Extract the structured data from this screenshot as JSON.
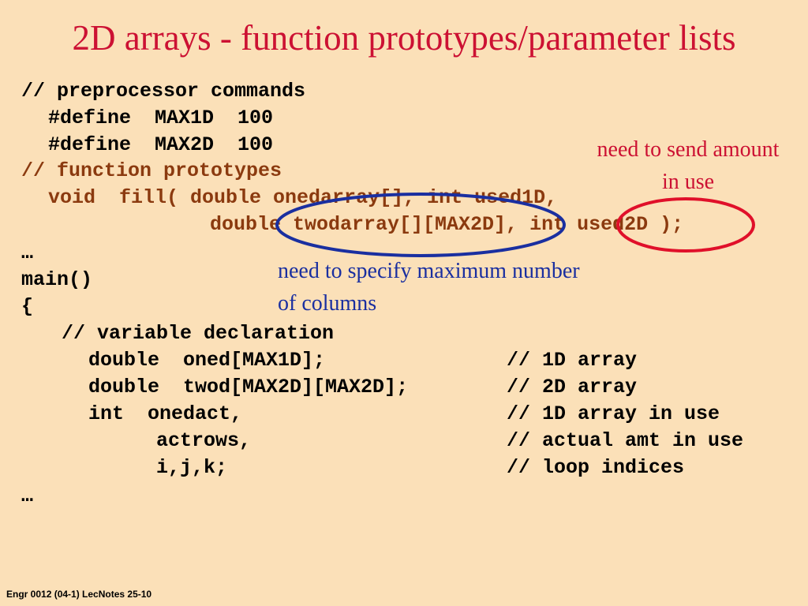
{
  "title": "2D arrays - function prototypes/parameter lists",
  "code_lines": {
    "l1": "// preprocessor commands",
    "l2": "#define  MAX1D  100",
    "l3": "#define  MAX2D  100",
    "l4": "// function prototypes",
    "l5": "void  fill( double onedarray[], int used1D,",
    "l6": "double twodarray[][MAX2D], int used2D );",
    "l7": "…",
    "l8": "main()",
    "l9": "{",
    "l10": "// variable declaration",
    "l11": "double  oned[MAX1D];",
    "l12": "double  twod[MAX2D][MAX2D];",
    "l13": "int  onedact,",
    "l14": "actrows,",
    "l15": "i,j,k;",
    "l16": "…"
  },
  "comments": {
    "c11": "// 1D array",
    "c12": "// 2D array",
    "c13": "// 1D array in use",
    "c14": "// actual amt in use",
    "c15": "// loop indices"
  },
  "annotations": {
    "red_line1": "need to send amount",
    "red_line2": "in use",
    "blue_line1": "need to specify maximum number",
    "blue_line2": "of columns"
  },
  "footer": "Engr 0012 (04-1) LecNotes 25-10",
  "colors": {
    "background": "#fbe0b8",
    "title": "#cc1133",
    "prototype_text": "#8b3a0f",
    "red_ellipse": "#e0102a",
    "blue_ellipse": "#1a2fa0"
  }
}
